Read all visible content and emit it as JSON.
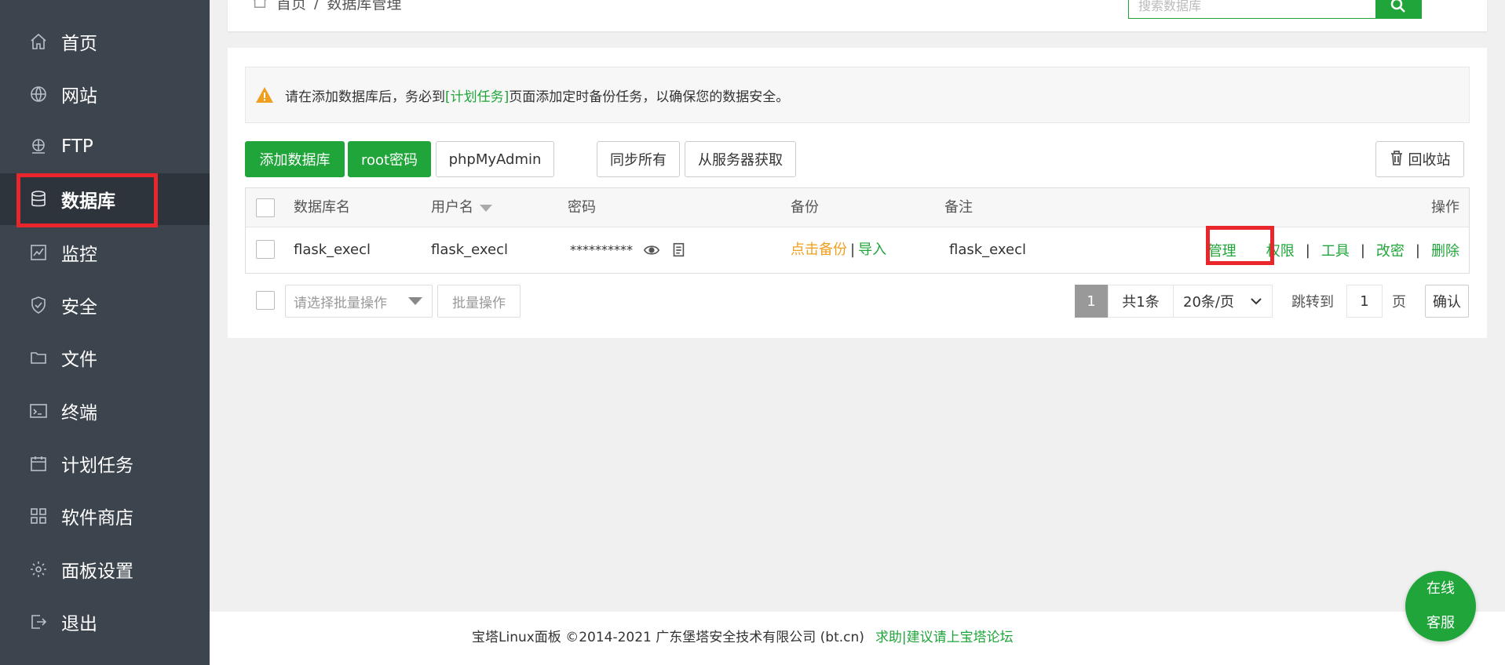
{
  "sidebar": {
    "items": [
      {
        "label": "首页",
        "icon": "home-icon"
      },
      {
        "label": "网站",
        "icon": "globe-icon"
      },
      {
        "label": "FTP",
        "icon": "ftp-icon"
      },
      {
        "label": "数据库",
        "icon": "database-icon",
        "active": true
      },
      {
        "label": "监控",
        "icon": "monitor-icon"
      },
      {
        "label": "安全",
        "icon": "shield-icon"
      },
      {
        "label": "文件",
        "icon": "folder-icon"
      },
      {
        "label": "终端",
        "icon": "terminal-icon"
      },
      {
        "label": "计划任务",
        "icon": "calendar-icon"
      },
      {
        "label": "软件商店",
        "icon": "grid-icon"
      },
      {
        "label": "面板设置",
        "icon": "gear-icon"
      },
      {
        "label": "退出",
        "icon": "logout-icon"
      }
    ]
  },
  "header": {
    "breadcrumb_home": "首页",
    "breadcrumb_sep": "/",
    "breadcrumb_current": "数据库管理",
    "search_placeholder": "搜索数据库"
  },
  "notice": {
    "prefix": "请在添加数据库后，务必到",
    "link": "[计划任务]",
    "suffix": "页面添加定时备份任务，以确保您的数据安全。"
  },
  "toolbar": {
    "add_db": "添加数据库",
    "root_pwd": "root密码",
    "phpmyadmin": "phpMyAdmin",
    "sync_all": "同步所有",
    "fetch_server": "从服务器获取",
    "recycle": "回收站"
  },
  "table": {
    "headers": {
      "name": "数据库名",
      "user": "用户名",
      "password": "密码",
      "backup": "备份",
      "note": "备注",
      "ops": "操作"
    },
    "rows": [
      {
        "name": "flask_execl",
        "user": "flask_execl",
        "password": "**********",
        "backup_action": "点击备份",
        "backup_sep": "|",
        "import_action": "导入",
        "note": "flask_execl",
        "ops": [
          "管理",
          "权限",
          "工具",
          "改密",
          "删除"
        ]
      }
    ]
  },
  "batch": {
    "select_placeholder": "请选择批量操作",
    "button": "批量操作"
  },
  "pagination": {
    "current": "1",
    "total": "共1条",
    "per_page": "20条/页",
    "jump_label": "跳转到",
    "jump_value": "1",
    "page_unit": "页",
    "confirm": "确认"
  },
  "footer": {
    "copyright": "宝塔Linux面板 ©2014-2021 广东堡塔安全技术有限公司 (bt.cn)",
    "link": "求助|建议请上宝塔论坛"
  },
  "chat": {
    "line1": "在线",
    "line2": "客服"
  },
  "colors": {
    "accent": "#20a53a",
    "sidebar_bg": "#3c444d",
    "highlight": "#e8262c",
    "backup_link": "#f0a020"
  }
}
